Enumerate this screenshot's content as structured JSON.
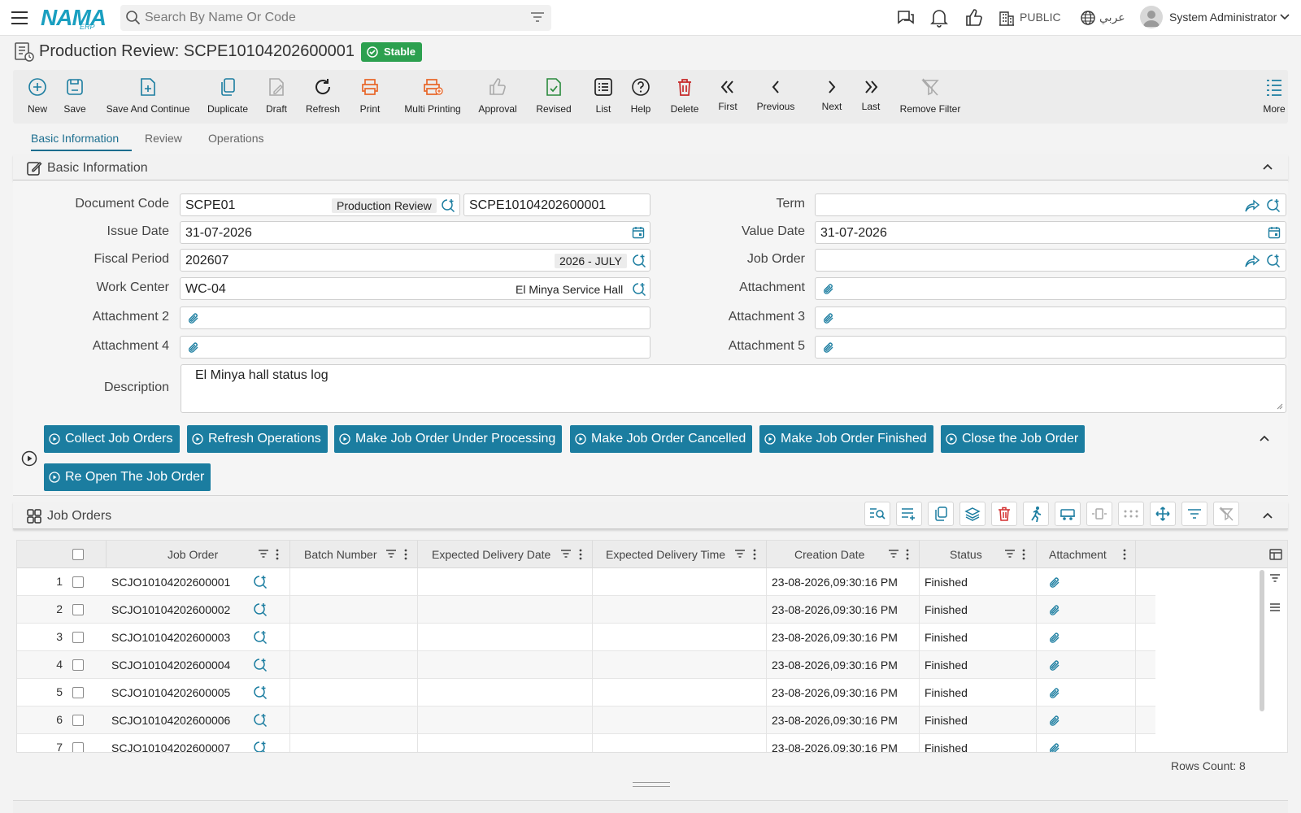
{
  "app": {
    "logo_main": "NAMA",
    "logo_sub": "ERP",
    "search_placeholder": "Search By Name Or Code",
    "branch": "PUBLIC",
    "language": "عربي",
    "user": "System Administrator"
  },
  "page": {
    "title": "Production Review: SCPE10104202600001",
    "status": "Stable",
    "status_color": "#2ca04f",
    "accent_color": "#1b7da0"
  },
  "toolbar": {
    "new": "New",
    "save": "Save",
    "save_continue": "Save And Continue",
    "duplicate": "Duplicate",
    "draft": "Draft",
    "refresh": "Refresh",
    "print": "Print",
    "multi_printing": "Multi Printing",
    "approval": "Approval",
    "revised": "Revised",
    "list": "List",
    "help": "Help",
    "delete": "Delete",
    "first": "First",
    "previous": "Previous",
    "next": "Next",
    "last": "Last",
    "remove_filter": "Remove Filter",
    "more": "More"
  },
  "tabs": {
    "basic": "Basic Information",
    "review": "Review",
    "operations": "Operations"
  },
  "basic_section": {
    "title": "Basic Information"
  },
  "form": {
    "document_code_label": "Document Code",
    "document_code": "SCPE01",
    "document_type": "Production Review",
    "document_number": "SCPE10104202600001",
    "term_label": "Term",
    "term": "",
    "issue_date_label": "Issue Date",
    "issue_date": "31-07-2026",
    "value_date_label": "Value Date",
    "value_date": "31-07-2026",
    "fiscal_period_label": "Fiscal Period",
    "fiscal_period": "202607",
    "fiscal_period_name": "2026 - JULY",
    "job_order_label": "Job Order",
    "job_order": "",
    "work_center_label": "Work Center",
    "work_center": "WC-04",
    "work_center_name": "El Minya Service Hall",
    "attachment_label": "Attachment",
    "attachment2_label": "Attachment 2",
    "attachment3_label": "Attachment 3",
    "attachment4_label": "Attachment 4",
    "attachment5_label": "Attachment 5",
    "description_label": "Description",
    "description": "El Minya hall status log"
  },
  "actions": {
    "collect": "Collect Job Orders",
    "refresh_ops": "Refresh Operations",
    "under_processing": "Make Job Order Under Processing",
    "cancelled": "Make Job Order Cancelled",
    "finished": "Make Job Order Finished",
    "close": "Close the Job Order",
    "reopen": "Re Open The Job Order"
  },
  "job_orders": {
    "title": "Job Orders",
    "columns": {
      "job_order": "Job Order",
      "batch_number": "Batch Number",
      "expected_delivery_date": "Expected Delivery Date",
      "expected_delivery_time": "Expected Delivery Time",
      "creation_date": "Creation Date",
      "status": "Status",
      "attachment": "Attachment"
    },
    "rows": [
      {
        "n": "1",
        "job_order": "SCJO10104202600001",
        "batch": "",
        "exp_date": "",
        "exp_time": "",
        "created": "23-08-2026,09:30:16 PM",
        "status": "Finished"
      },
      {
        "n": "2",
        "job_order": "SCJO10104202600002",
        "batch": "",
        "exp_date": "",
        "exp_time": "",
        "created": "23-08-2026,09:30:16 PM",
        "status": "Finished"
      },
      {
        "n": "3",
        "job_order": "SCJO10104202600003",
        "batch": "",
        "exp_date": "",
        "exp_time": "",
        "created": "23-08-2026,09:30:16 PM",
        "status": "Finished"
      },
      {
        "n": "4",
        "job_order": "SCJO10104202600004",
        "batch": "",
        "exp_date": "",
        "exp_time": "",
        "created": "23-08-2026,09:30:16 PM",
        "status": "Finished"
      },
      {
        "n": "5",
        "job_order": "SCJO10104202600005",
        "batch": "",
        "exp_date": "",
        "exp_time": "",
        "created": "23-08-2026,09:30:16 PM",
        "status": "Finished"
      },
      {
        "n": "6",
        "job_order": "SCJO10104202600006",
        "batch": "",
        "exp_date": "",
        "exp_time": "",
        "created": "23-08-2026,09:30:16 PM",
        "status": "Finished"
      },
      {
        "n": "7",
        "job_order": "SCJO10104202600007",
        "batch": "",
        "exp_date": "",
        "exp_time": "",
        "created": "23-08-2026,09:30:16 PM",
        "status": "Finished"
      }
    ],
    "rows_count": "Rows Count: 8"
  }
}
